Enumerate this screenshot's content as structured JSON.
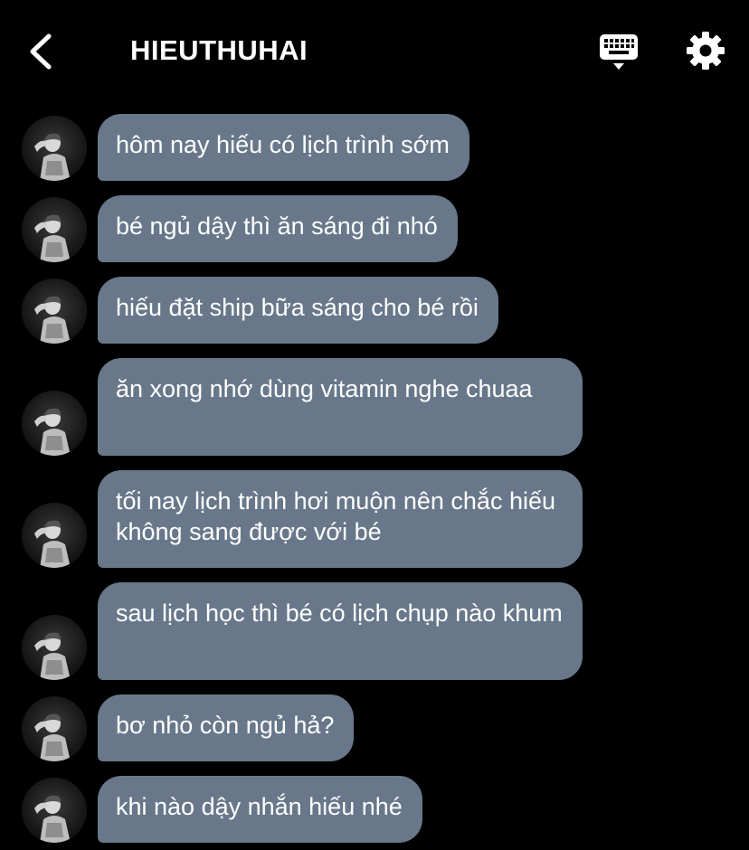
{
  "header": {
    "title": "HIEUTHUHAI"
  },
  "messages": [
    {
      "text": "hôm nay hiếu có lịch trình sớm"
    },
    {
      "text": "bé ngủ dậy thì ăn sáng đi nhó"
    },
    {
      "text": "hiếu đặt ship bữa sáng cho bé rồi"
    },
    {
      "text": "ăn xong nhớ dùng vitamin nghe chuaa"
    },
    {
      "text": "tối nay lịch trình hơi muộn nên chắc hiếu không sang được với bé"
    },
    {
      "text": "sau lịch học thì bé có lịch chụp nào khum"
    },
    {
      "text": "bơ nhỏ còn ngủ hả?"
    },
    {
      "text": "khi nào dậy nhắn hiếu nhé"
    }
  ],
  "colors": {
    "background": "#000000",
    "bubble": "#68788a",
    "text": "#ffffff"
  },
  "icons": {
    "back": "chevron-left-icon",
    "keyboard": "keyboard-icon",
    "settings": "gear-icon"
  }
}
